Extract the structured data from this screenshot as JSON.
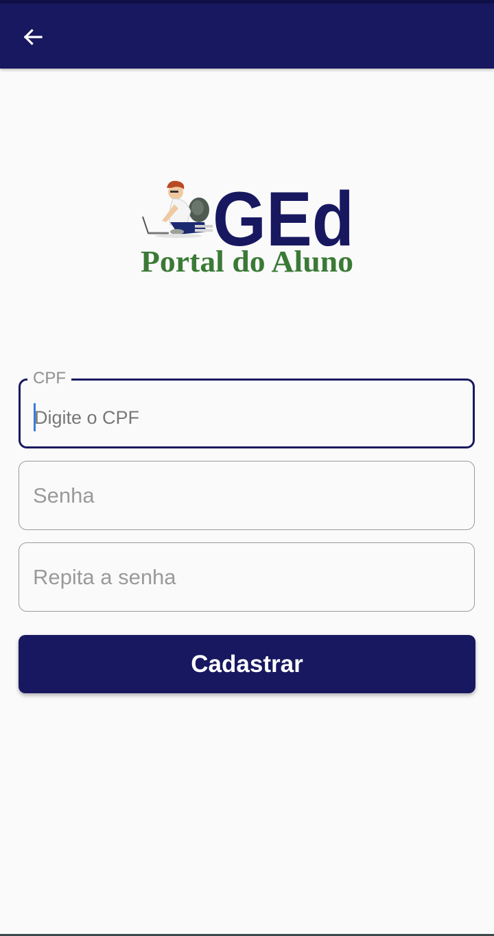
{
  "colors": {
    "primary": "#181860",
    "logo_green": "#3a7a36",
    "background": "#fafafa",
    "caret": "#3d7bd9"
  },
  "appbar": {
    "back_icon": "arrow-left-icon"
  },
  "logo": {
    "brand": "GEd",
    "subtitle": "Portal do Aluno",
    "illustration_icon": "student-with-laptop-icon"
  },
  "form": {
    "cpf": {
      "label": "CPF",
      "placeholder": "Digite o CPF",
      "value": ""
    },
    "senha": {
      "placeholder": "Senha",
      "value": ""
    },
    "repita_senha": {
      "placeholder": "Repita a senha",
      "value": ""
    },
    "submit_label": "Cadastrar"
  }
}
